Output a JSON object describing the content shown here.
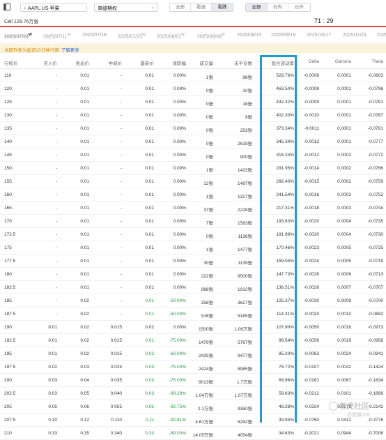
{
  "search": {
    "value": "AAPL.US 苹果"
  },
  "option_type": {
    "value": "单腿期权"
  },
  "filter1": [
    {
      "label": "全部",
      "on": false
    },
    {
      "label": "看涨",
      "on": false
    },
    {
      "label": "看跌",
      "on": true
    }
  ],
  "filter2": [
    {
      "label": "全部",
      "on": true
    },
    {
      "label": "价内",
      "on": false
    },
    {
      "label": "价外",
      "on": false
    }
  ],
  "call": {
    "label": "Call 129.76万张",
    "timer": "71 : 29"
  },
  "dates": [
    {
      "label": "2025/07/03",
      "sup": "W",
      "on": true
    },
    {
      "label": "2025/07/11",
      "sup": "W",
      "on": false
    },
    {
      "label": "2025/07/18",
      "sup": "",
      "on": false
    },
    {
      "label": "2025/07/25",
      "sup": "W",
      "on": false
    },
    {
      "label": "2025/08/01",
      "sup": "W",
      "on": false
    },
    {
      "label": "2025/08/08",
      "sup": "W",
      "on": false
    },
    {
      "label": "2025/08/15",
      "sup": "",
      "on": false
    },
    {
      "label": "2025/09/19",
      "sup": "",
      "on": false
    },
    {
      "label": "2025/10/17",
      "sup": "",
      "on": false
    },
    {
      "label": "2025/11/21",
      "sup": "",
      "on": false
    },
    {
      "label": "2025",
      "sup": "",
      "on": false
    }
  ],
  "notice": {
    "text": "当前列表为延迟15分钟行情",
    "link": "了解更多"
  },
  "columns": [
    "行权价",
    "买入价",
    "卖出价",
    "中间价",
    "最新价",
    "涨跌幅",
    "成交量",
    "未平仓数",
    "隐含波动率",
    "Delta",
    "Gamma",
    "Theta"
  ],
  "rows": [
    [
      "110",
      "-",
      "0.01",
      "-",
      "0.01",
      "0.00%",
      "1张",
      "98张",
      "529.76%",
      "-0.0008",
      "0.0001",
      "-0.0803"
    ],
    [
      "120",
      "-",
      "0.01",
      "-",
      "0.01",
      "0.00%",
      "0张",
      "10张",
      "463.50%",
      "-0.0008",
      "0.0001",
      "-0.0796"
    ],
    [
      "125",
      "-",
      "0.01",
      "-",
      "0.01",
      "0.00%",
      "0张",
      "18张",
      "432.32%",
      "-0.0009",
      "0.0001",
      "-0.0791"
    ],
    [
      "130",
      "-",
      "0.01",
      "-",
      "0.01",
      "0.00%",
      "0张",
      "9张",
      "402.30%",
      "-0.0010",
      "0.0001",
      "-0.0787"
    ],
    [
      "135",
      "-",
      "0.01",
      "-",
      "0.01",
      "0.00%",
      "0张",
      "253张",
      "373.34%",
      "-0.0011",
      "0.0001",
      "-0.0781"
    ],
    [
      "140",
      "-",
      "0.01",
      "-",
      "0.01",
      "0.00%",
      "0张",
      "2619张",
      "345.34%",
      "-0.0012",
      "0.0001",
      "-0.0777"
    ],
    [
      "145",
      "-",
      "0.01",
      "-",
      "0.01",
      "0.00%",
      "0张",
      "900张",
      "318.24%",
      "-0.0012",
      "0.0002",
      "-0.0772"
    ],
    [
      "150",
      "-",
      "0.01",
      "-",
      "0.01",
      "0.00%",
      "1张",
      "1423张",
      "291.95%",
      "-0.0014",
      "0.0002",
      "-0.0766"
    ],
    [
      "155",
      "-",
      "0.01",
      "-",
      "0.01",
      "0.00%",
      "12张",
      "1497张",
      "266.40%",
      "-0.0015",
      "0.0002",
      "-0.0759"
    ],
    [
      "160",
      "-",
      "0.01",
      "-",
      "0.01",
      "0.00%",
      "1张",
      "1327张",
      "241.54%",
      "-0.0016",
      "0.0003",
      "-0.0752"
    ],
    [
      "165",
      "-",
      "0.01",
      "-",
      "0.01",
      "0.00%",
      "37张",
      "2228张",
      "217.31%",
      "-0.0018",
      "0.0003",
      "-0.0744"
    ],
    [
      "170",
      "-",
      "0.01",
      "-",
      "0.01",
      "0.00%",
      "7张",
      "1583张",
      "193.63%",
      "-0.0020",
      "0.0004",
      "-0.0735"
    ],
    [
      "172.5",
      "-",
      "0.01",
      "-",
      "0.01",
      "0.00%",
      "0张",
      "1136张",
      "181.99%",
      "-0.0020",
      "0.0004",
      "-0.0730"
    ],
    [
      "175",
      "-",
      "0.01",
      "-",
      "0.01",
      "0.00%",
      "1张",
      "1477张",
      "170.46%",
      "-0.0023",
      "0.0005",
      "-0.0725"
    ],
    [
      "177.5",
      "-",
      "0.01",
      "-",
      "0.01",
      "0.00%",
      "30张",
      "1139张",
      "159.04%",
      "-0.0024",
      "0.0005",
      "-0.0719"
    ],
    [
      "180",
      "-",
      "0.01",
      "-",
      "0.01",
      "0.00%",
      "222张",
      "8500张",
      "147.73%",
      "-0.0026",
      "0.0006",
      "-0.0713"
    ],
    [
      "182.5",
      "-",
      "0.01",
      "-",
      "0.01",
      "0.00%",
      "988张",
      "1912张",
      "136.51%",
      "-0.0028",
      "0.0007",
      "-0.0707"
    ],
    [
      "185",
      "-",
      "0.02",
      "-",
      "0.01",
      "-50.00%",
      "258张",
      "3627张",
      "125.37%",
      "-0.0030",
      "0.0009",
      "-0.0700"
    ],
    [
      "187.5",
      "-",
      "0.02",
      "-",
      "0.01",
      "-50.00%",
      "916张",
      "5185张",
      "114.31%",
      "-0.0033",
      "0.0010",
      "-0.0692"
    ],
    [
      "190",
      "0.01",
      "0.02",
      "0.015",
      "0.02",
      "0.00%",
      "1500张",
      "1.06万张",
      "107.90%",
      "-0.0050",
      "0.0016",
      "-0.0973"
    ],
    [
      "192.5",
      "0.01",
      "0.02",
      "0.015",
      "0.01",
      "-75.00%",
      "1479张",
      "5767张",
      "96.54%",
      "-0.0056",
      "0.0019",
      "-0.0958"
    ],
    [
      "195",
      "0.01",
      "0.02",
      "0.015",
      "0.02",
      "-60.00%",
      "2425张",
      "9477张",
      "85.20%",
      "-0.0063",
      "0.0024",
      "-0.0941"
    ],
    [
      "197.5",
      "0.02",
      "0.03",
      "0.025",
      "0.03",
      "-75.00%",
      "2424张",
      "8985张",
      "78.72%",
      "-0.0107",
      "0.0042",
      "-0.1424"
    ],
    [
      "200",
      "0.03",
      "0.04",
      "0.035",
      "0.03",
      "-75.00%",
      "8013张",
      "1.7万张",
      "69.96%",
      "-0.0161",
      "0.0067",
      "-0.1834"
    ],
    [
      "202.5",
      "0.03",
      "0.05",
      "0.040",
      "0.03",
      "-89.29%",
      "1.04万张",
      "1.07万张",
      "58.63%",
      "-0.0212",
      "0.0101",
      "-0.1699"
    ],
    [
      "205",
      "0.05",
      "0.06",
      "0.055",
      "0.05",
      "-92.75%",
      "2.1万张",
      "9350张",
      "48.28%",
      "-0.0334",
      "0.0179",
      "-0.2142"
    ],
    [
      "207.5",
      "0.10",
      "0.12",
      "0.110",
      "0.11",
      "-92.81%",
      "4.61万张",
      "6292张",
      "39.93%",
      "-0.0760",
      "0.0412",
      "-0.3776"
    ],
    [
      "210",
      "0.33",
      "0.35",
      "0.340",
      "0.33",
      "-89.00%",
      "14.05万张",
      "4054张",
      "34.63%",
      "-0.2021",
      "0.0944",
      "-0.7006"
    ]
  ],
  "colors": {
    "highlight": "#1e9bd7",
    "red_line": "#d94545",
    "negative": "#1a9e3a",
    "notice_bg": "#fbf3d9",
    "notice_text": "#d08a00",
    "link": "#2866d1"
  },
  "icons": {
    "sidebar": "sidebar-toggle-icon",
    "search": "search-icon",
    "dropdown": "chevron-down-icon"
  },
  "watermark": {
    "line1": "老虎社区",
    "line2": "@霆展108"
  }
}
